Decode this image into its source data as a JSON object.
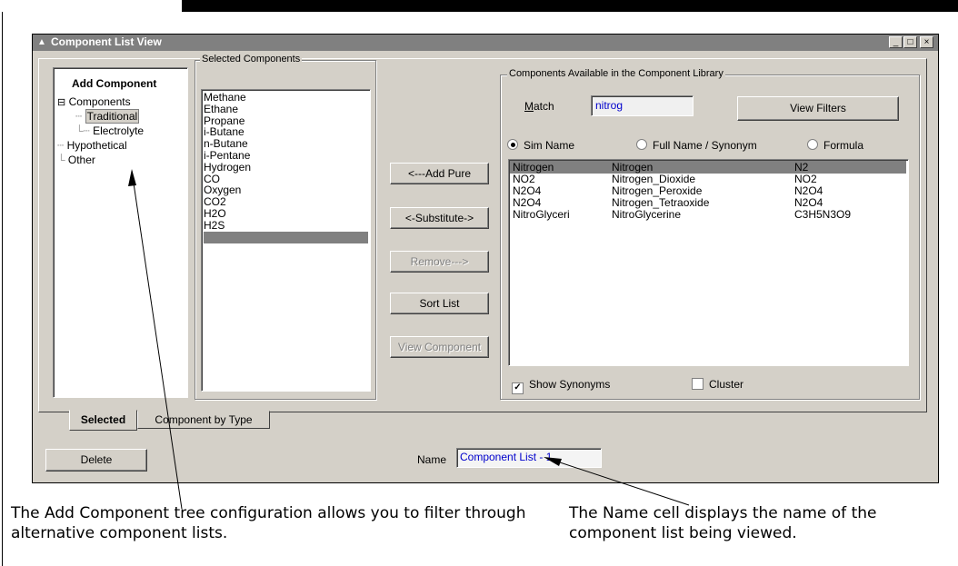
{
  "window": {
    "title": "Component List View",
    "minimize": "_",
    "maximize": "□",
    "close": "×"
  },
  "add_component": {
    "heading": "Add Component",
    "tree": [
      {
        "label": "Components",
        "expander": "⊟"
      },
      {
        "label": "Traditional",
        "selected": true
      },
      {
        "label": "Electrolyte"
      },
      {
        "label": "Hypothetical"
      },
      {
        "label": "Other"
      }
    ]
  },
  "selected_components": {
    "label": "Selected Components",
    "items": [
      "Methane",
      "Ethane",
      "Propane",
      "i-Butane",
      "n-Butane",
      "i-Pentane",
      "Hydrogen",
      "CO",
      "Oxygen",
      "CO2",
      "H2O",
      "H2S"
    ]
  },
  "middle_buttons": {
    "add_pure": "<---Add Pure",
    "substitute": "<-Substitute->",
    "remove": "Remove--->",
    "sort_list": "Sort List",
    "view_component": "View Component"
  },
  "library": {
    "label": "Components Available in the Component Library",
    "match_label": "Match",
    "match_value": "nitrog",
    "view_filters": "View Filters",
    "radios": [
      {
        "label": "Sim Name",
        "checked": true
      },
      {
        "label": "Full Name / Synonym",
        "checked": false
      },
      {
        "label": "Formula",
        "checked": false
      }
    ],
    "rows": [
      {
        "sim": "Nitrogen",
        "full": "Nitrogen",
        "formula": "N2",
        "selected": true
      },
      {
        "sim": "NO2",
        "full": "Nitrogen_Dioxide",
        "formula": "NO2"
      },
      {
        "sim": "N2O4",
        "full": "Nitrogen_Peroxide",
        "formula": "N2O4"
      },
      {
        "sim": "N2O4",
        "full": "Nitrogen_Tetraoxide",
        "formula": "N2O4"
      },
      {
        "sim": "NitroGlyceri",
        "full": "NitroGlycerine",
        "formula": "C3H5N3O9"
      }
    ],
    "show_synonyms": "Show Synonyms",
    "cluster": "Cluster"
  },
  "tabs": [
    "Selected",
    "Component by Type"
  ],
  "footer": {
    "delete": "Delete",
    "name_label": "Name",
    "name_value": "Component List - 1"
  },
  "captions": {
    "left": "The Add Component tree configuration allows you to filter through alternative component lists.",
    "right": "The Name cell displays the name of the component list being viewed."
  }
}
